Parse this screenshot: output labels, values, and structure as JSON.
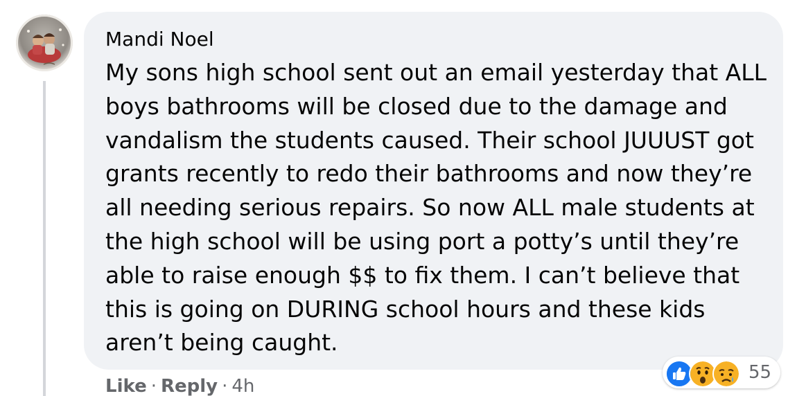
{
  "comment": {
    "author": "Mandi Noel",
    "lines": [
      "My sons high school sent out an email yesterday that ALL",
      "boys bathrooms will be closed due to the damage and",
      "vandalism the students caused. Their school JUUUST got",
      "grants recently to redo their bathrooms and now they’re",
      "all needing serious repairs. So now ALL male students at",
      "the high school will be using port a potty’s until they’re",
      "able to raise enough $$ to fix them. I can’t believe that",
      "this is going on DURING school hours and these kids",
      "aren’t being caught."
    ]
  },
  "reactions": {
    "icons": [
      "like-icon",
      "wow-icon",
      "sad-icon"
    ],
    "count": "55",
    "colors": {
      "like": "#1877f2",
      "wow": "#f7b125",
      "sad": "#f7b125"
    }
  },
  "actions": {
    "like": "Like",
    "reply": "Reply",
    "separator": "·",
    "timestamp": "4h"
  },
  "colors": {
    "bubble": "#f0f2f5",
    "text": "#050505",
    "secondary_text": "#65676b"
  }
}
